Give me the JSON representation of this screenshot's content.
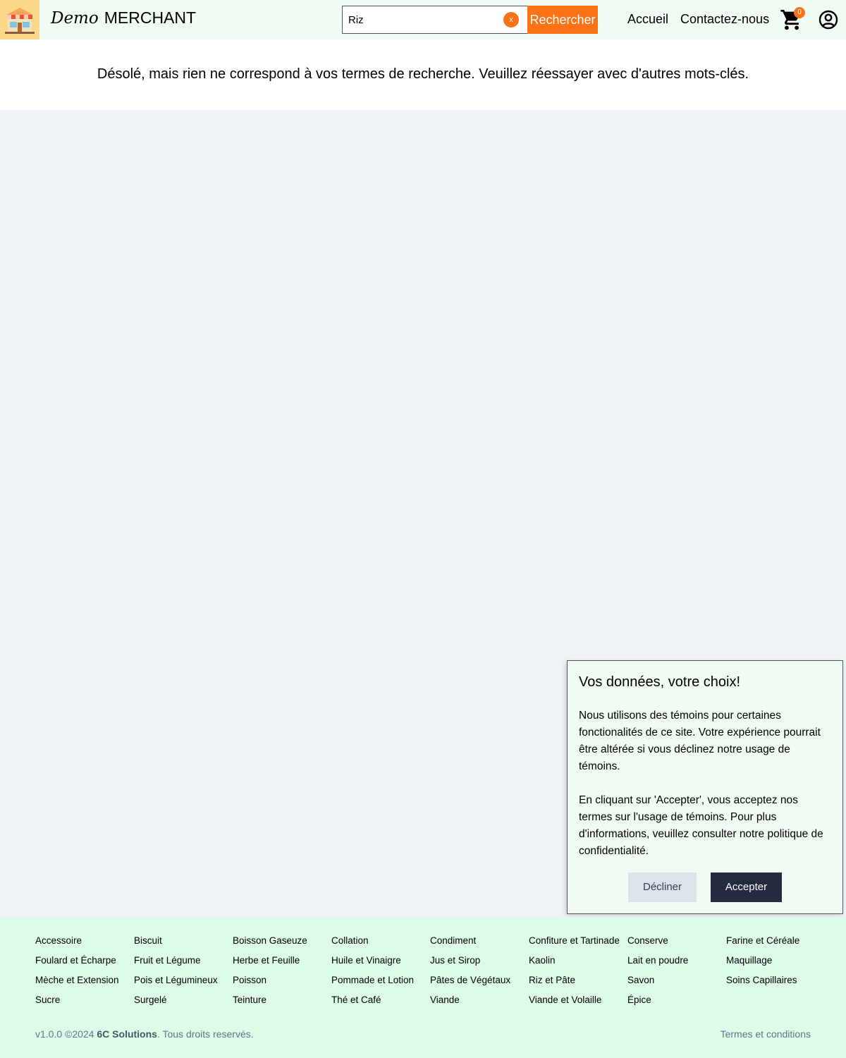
{
  "header": {
    "brand_script": "Demo",
    "brand_name": "MERCHANT",
    "search_value": "Riz",
    "clear_label": "x",
    "search_button": "Rechercher",
    "nav_home": "Accueil",
    "nav_contact": "Contactez-nous",
    "cart_count": "0",
    "icons": [
      "store-logo-icon",
      "cart-icon",
      "user-circle-icon"
    ],
    "accent_color": "#f97316"
  },
  "result": {
    "message": "Désolé, mais rien ne correspond à vos termes de recherche. Veuillez réessayer avec d'autres mots-clés."
  },
  "cookie": {
    "title": "Vos données, votre choix!",
    "paragraph1": "Nous utilisons des témoins pour certaines fonctionalités de ce site. Votre expérience pourrait être altérée si vous déclinez notre usage de témoins.",
    "paragraph2": "En cliquant sur 'Accepter', vous acceptez nos termes sur l'usage de témoins. Pour plus d'informations, veuillez consulter notre politique de confidentialité.",
    "decline": "Décliner",
    "accept": "Accepter"
  },
  "footer": {
    "categories": [
      "Accessoire",
      "Biscuit",
      "Boisson Gaseuze",
      "Collation",
      "Condiment",
      "Confiture et Tartinade",
      "Conserve",
      "Farine et Céréale",
      "Foulard et Écharpe",
      "Fruit et Légume",
      "Herbe et Feuille",
      "Huile et Vinaigre",
      "Jus et Sirop",
      "Kaolin",
      "Lait en poudre",
      "Maquillage",
      "Mèche et Extension",
      "Pois et Légumineux",
      "Poisson",
      "Pommade et Lotion",
      "Pâtes de Végétaux",
      "Riz et Pâte",
      "Savon",
      "Soins Capillaires",
      "Sucre",
      "Surgelé",
      "Teinture",
      "Thé et Café",
      "Viande",
      "Viande et Volaille",
      "Épice"
    ],
    "copyright_prefix": "v1.0.0 ©2024",
    "company": "6C Solutions",
    "copyright_suffix": ". Tous droits reservés.",
    "terms": "Termes et conditions"
  }
}
